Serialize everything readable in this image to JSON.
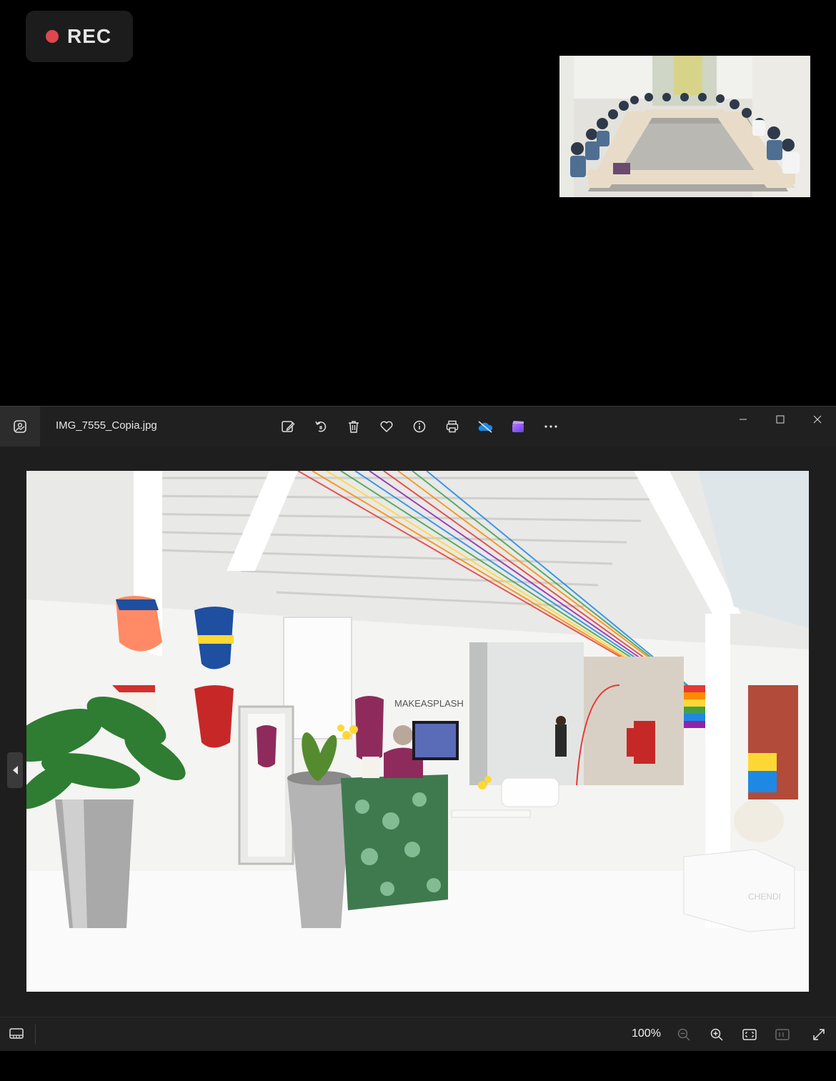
{
  "recording": {
    "label": "REC",
    "dot_color": "#e0464e"
  },
  "participant_video": {
    "icon": "video-tile"
  },
  "window": {
    "file_name": "IMG_7555_Copia.jpg",
    "toolbar": [
      {
        "name": "edit-image-icon",
        "tooltip": "Edit image"
      },
      {
        "name": "rotate-icon",
        "tooltip": "Rotate"
      },
      {
        "name": "delete-icon",
        "tooltip": "Delete"
      },
      {
        "name": "favorite-icon",
        "tooltip": "Favorite"
      },
      {
        "name": "info-icon",
        "tooltip": "File information"
      },
      {
        "name": "print-icon",
        "tooltip": "Print"
      },
      {
        "name": "onedrive-icon",
        "tooltip": "OneDrive"
      },
      {
        "name": "clipchamp-icon",
        "tooltip": "Clipchamp"
      },
      {
        "name": "more-icon",
        "tooltip": "See more"
      }
    ],
    "photo_sign": "MAKEASPLASH",
    "photo_sign_2": "CHENDI"
  },
  "status": {
    "zoom_level": "100%"
  },
  "colors": {
    "window_bg": "#202020",
    "accent_onedrive": "#1e88e5",
    "accent_clipchamp": "#8a5cf6"
  }
}
